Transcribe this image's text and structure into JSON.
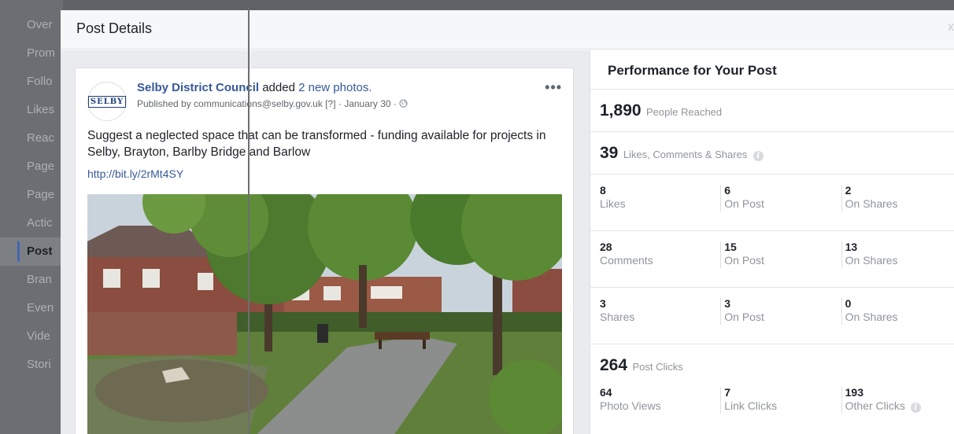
{
  "sidebar": {
    "items": [
      {
        "label": "Over"
      },
      {
        "label": "Prom"
      },
      {
        "label": "Follo"
      },
      {
        "label": "Likes"
      },
      {
        "label": "Reac"
      },
      {
        "label": "Page"
      },
      {
        "label": "Page"
      },
      {
        "label": "Actic"
      },
      {
        "label": "Post",
        "active": true
      },
      {
        "label": "Bran"
      },
      {
        "label": "Even"
      },
      {
        "label": "Vide"
      },
      {
        "label": "Stori"
      }
    ]
  },
  "modal": {
    "title": "Post Details",
    "close_label": "x"
  },
  "post": {
    "avatar_text": "SELBY",
    "page_name": "Selby District Council",
    "action_text": " added ",
    "photo_link": "2 new photos.",
    "published_by": "Published by communications@selby.gov.uk [?] · January 30 · ",
    "globe_icon": "globe-icon",
    "more_label": "•••",
    "text": "Suggest a neglected space that can be transformed - funding available for projects in Selby, Brayton, Barlby Bridge and Barlow",
    "url": "http://bit.ly/2rMt4SY",
    "photo_icon": "photo-image"
  },
  "performance": {
    "title": "Performance for Your Post",
    "reached": {
      "value": "1,890",
      "label": "People Reached"
    },
    "engagement": {
      "value": "39",
      "label": "Likes, Comments & Shares"
    },
    "rows": [
      {
        "cells": [
          {
            "value": "8",
            "label": "Likes"
          },
          {
            "value": "6",
            "label": "On Post"
          },
          {
            "value": "2",
            "label": "On Shares"
          }
        ]
      },
      {
        "cells": [
          {
            "value": "28",
            "label": "Comments"
          },
          {
            "value": "15",
            "label": "On Post"
          },
          {
            "value": "13",
            "label": "On Shares"
          }
        ]
      },
      {
        "cells": [
          {
            "value": "3",
            "label": "Shares"
          },
          {
            "value": "3",
            "label": "On Post"
          },
          {
            "value": "0",
            "label": "On Shares"
          }
        ]
      }
    ],
    "clicks": {
      "value": "264",
      "label": "Post Clicks"
    },
    "click_cells": [
      {
        "value": "64",
        "label": "Photo Views"
      },
      {
        "value": "7",
        "label": "Link Clicks"
      },
      {
        "value": "193",
        "label": "Other Clicks"
      }
    ],
    "info_icon": "i"
  }
}
